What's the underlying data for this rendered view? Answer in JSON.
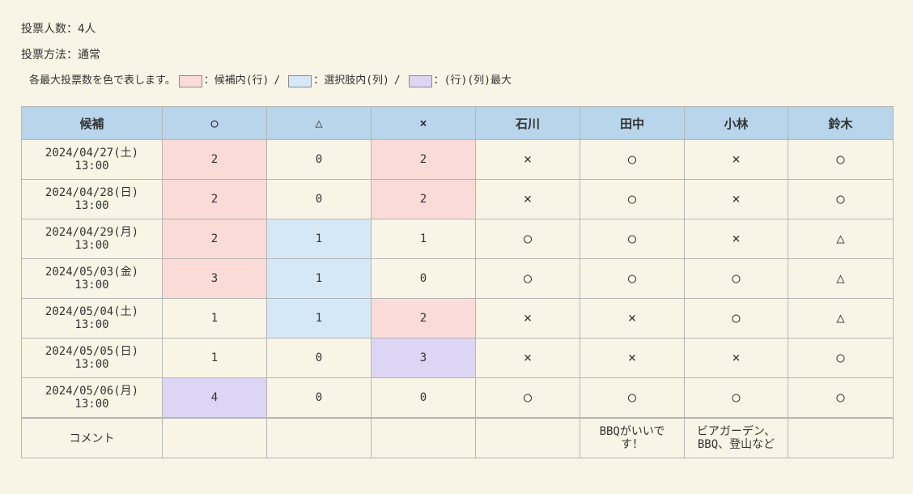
{
  "info": {
    "voter_count": "投票人数：4人",
    "vote_method": "投票方法：通常"
  },
  "legend": {
    "intro": "各最大投票数を色で表します。",
    "row_label": "：候補内(行)",
    "col_label": "：選択肢内(列)",
    "both_label": "：(行)(列)最大",
    "separator": "/",
    "row_color": "#fadbd8",
    "col_color": "#d5e8f7",
    "both_color": "#dcd5f4"
  },
  "colors": {
    "page_background": "#f9f5e6",
    "header_background": "#b8d5eb",
    "border": "#b5b5b5"
  },
  "table": {
    "headers": [
      "候補",
      "○",
      "△",
      "×",
      "石川",
      "田中",
      "小林",
      "鈴木"
    ],
    "rows": [
      {
        "date": "2024/04/27(土)",
        "time": "13:00",
        "counts": [
          "2",
          "0",
          "2"
        ],
        "highlight": [
          "row",
          "",
          "row"
        ],
        "votes": [
          "×",
          "○",
          "×",
          "○"
        ]
      },
      {
        "date": "2024/04/28(日)",
        "time": "13:00",
        "counts": [
          "2",
          "0",
          "2"
        ],
        "highlight": [
          "row",
          "",
          "row"
        ],
        "votes": [
          "×",
          "○",
          "×",
          "○"
        ]
      },
      {
        "date": "2024/04/29(月)",
        "time": "13:00",
        "counts": [
          "2",
          "1",
          "1"
        ],
        "highlight": [
          "row",
          "col",
          ""
        ],
        "votes": [
          "○",
          "○",
          "×",
          "△"
        ]
      },
      {
        "date": "2024/05/03(金)",
        "time": "13:00",
        "counts": [
          "3",
          "1",
          "0"
        ],
        "highlight": [
          "row",
          "col",
          ""
        ],
        "votes": [
          "○",
          "○",
          "○",
          "△"
        ]
      },
      {
        "date": "2024/05/04(土)",
        "time": "13:00",
        "counts": [
          "1",
          "1",
          "2"
        ],
        "highlight": [
          "",
          "col",
          "row"
        ],
        "votes": [
          "×",
          "×",
          "○",
          "△"
        ]
      },
      {
        "date": "2024/05/05(日)",
        "time": "13:00",
        "counts": [
          "1",
          "0",
          "3"
        ],
        "highlight": [
          "",
          "",
          "both"
        ],
        "votes": [
          "×",
          "×",
          "×",
          "○"
        ]
      },
      {
        "date": "2024/05/06(月)",
        "time": "13:00",
        "counts": [
          "4",
          "0",
          "0"
        ],
        "highlight": [
          "both",
          "",
          ""
        ],
        "votes": [
          "○",
          "○",
          "○",
          "○"
        ]
      }
    ]
  },
  "comments": {
    "label": "コメント",
    "values": [
      "",
      "",
      "",
      "",
      "BBQがいいです！",
      "ビアガーデン、BBQ、登山など",
      ""
    ]
  }
}
